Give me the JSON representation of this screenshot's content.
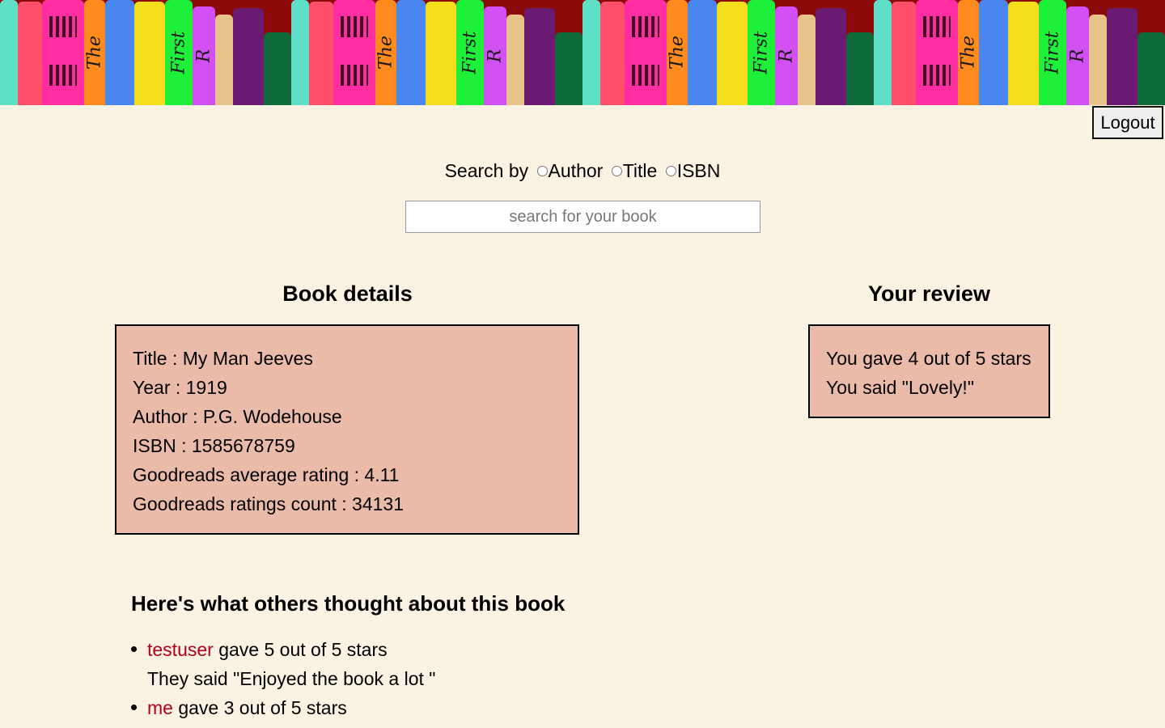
{
  "banner": {
    "spine_texts": [
      "The",
      "First",
      "R"
    ],
    "tile_count": 4
  },
  "header": {
    "logout_label": "Logout"
  },
  "search": {
    "label": "Search by",
    "options": [
      "Author",
      "Title",
      "ISBN"
    ],
    "placeholder": "search for your book"
  },
  "book_details": {
    "heading": "Book details",
    "lines": [
      "Title : My Man Jeeves",
      "Year : 1919",
      "Author : P.G. Wodehouse",
      "ISBN : 1585678759",
      "Goodreads average rating : 4.11",
      "Goodreads ratings count : 34131"
    ]
  },
  "your_review": {
    "heading": "Your review",
    "lines": [
      "You gave 4 out of 5 stars",
      "You said \"Lovely!\""
    ]
  },
  "others": {
    "heading": "Here's what others thought about this book",
    "reviews": [
      {
        "user": "testuser",
        "rating_text": " gave 5 out of 5 stars",
        "comment": "They said \"Enjoyed the book a lot \""
      },
      {
        "user": "me",
        "rating_text": " gave 3 out of 5 stars",
        "comment": ""
      }
    ]
  },
  "colors": {
    "background": "#faf2e3",
    "card": "#ebbba9",
    "user_link": "#b3001b"
  }
}
